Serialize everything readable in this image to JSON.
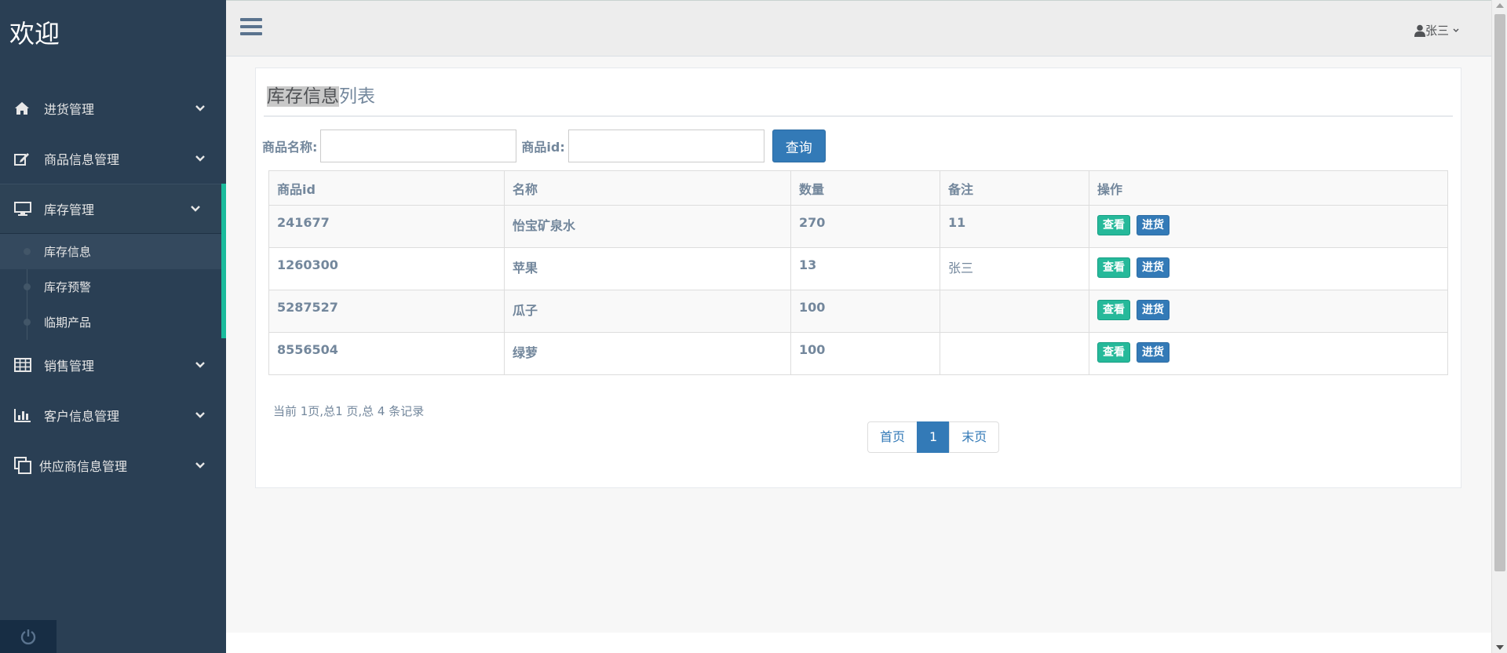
{
  "sidebar": {
    "brand": "欢迎",
    "items": [
      {
        "label": "进货管理",
        "icon": "home-icon"
      },
      {
        "label": "商品信息管理",
        "icon": "edit-icon"
      },
      {
        "label": "库存管理",
        "icon": "desktop-icon"
      },
      {
        "label": "销售管理",
        "icon": "table-icon"
      },
      {
        "label": "客户信息管理",
        "icon": "bar-chart-icon"
      },
      {
        "label": "供应商信息管理",
        "icon": "clone-icon"
      }
    ],
    "sub_items": [
      "库存信息",
      "库存预警",
      "临期产品"
    ]
  },
  "topnav": {
    "user_name": "张三"
  },
  "main": {
    "title_highlight": "库存信息",
    "title_rest": "列表",
    "search": {
      "name_label": "商品名称:",
      "id_label": "商品id:",
      "button_label": "查询"
    },
    "table": {
      "headers": [
        "商品id",
        "名称",
        "数量",
        "备注",
        "操作"
      ],
      "rows": [
        {
          "id": "241677",
          "name": "怡宝矿泉水",
          "qty": "270",
          "note": "11"
        },
        {
          "id": "1260300",
          "name": "苹果",
          "qty": "13",
          "note": "张三"
        },
        {
          "id": "5287527",
          "name": "瓜子",
          "qty": "100",
          "note": ""
        },
        {
          "id": "8556504",
          "name": "绿萝",
          "qty": "100",
          "note": ""
        }
      ],
      "view_label": "查看",
      "stock_label": "进货"
    },
    "pagination": {
      "info": "当前 1页,总1 页,总 4 条记录",
      "first": "首页",
      "current": "1",
      "last": "末页"
    }
  },
  "colors": {
    "sidebar_bg": "#2a3f54",
    "accent": "#1abb9c",
    "primary": "#337ab7",
    "success": "#26b99a"
  }
}
